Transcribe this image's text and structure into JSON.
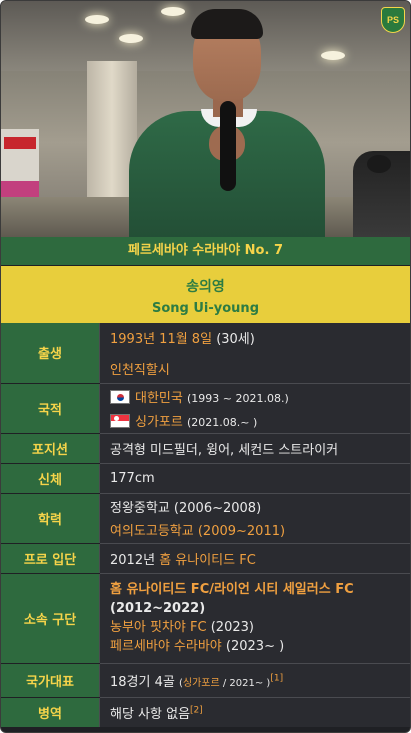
{
  "caption": "페르세바야 수라바야 No. 7",
  "logo_text": "PS",
  "name": {
    "korean": "송의영",
    "english": "Song Ui-young"
  },
  "info": {
    "birth": {
      "label": "출생",
      "date": "1993년 11월 8일",
      "age": "(30세)",
      "place": "인천직할시"
    },
    "nationality": {
      "label": "국적",
      "country1": "대한민국",
      "period1": "(1993 ~ 2021.08.)",
      "country2": "싱가포르",
      "period2": "(2021.08.~ )"
    },
    "position": {
      "label": "포지션",
      "value": "공격형 미드필더, 윙어, 세컨드 스트라이커"
    },
    "height": {
      "label": "신체",
      "value": "177cm"
    },
    "education": {
      "label": "학력",
      "school1": "정왕중학교 (2006~2008)",
      "school2": "여의도고등학교 (2009~2011)"
    },
    "debut": {
      "label": "프로 입단",
      "year": "2012년",
      "club": "홈 유나이티드 FC"
    },
    "clubs": {
      "label": "소속 구단",
      "club1": "홈 유나이티드 FC/라이언 시티 세일러스 FC",
      "club1_period": "(2012~2022)",
      "club2": "농부아 핏차야 FC",
      "club2_period": "(2023)",
      "club3": "페르세바야 수라바야",
      "club3_period": "(2023~ )"
    },
    "national": {
      "label": "국가대표",
      "caps": "18경기 4골",
      "team": "싱가포르",
      "period": " / 2021~ )",
      "ref": "[1]"
    },
    "military": {
      "label": "병역",
      "value": "해당 사항 없음",
      "ref": "[2]"
    }
  }
}
